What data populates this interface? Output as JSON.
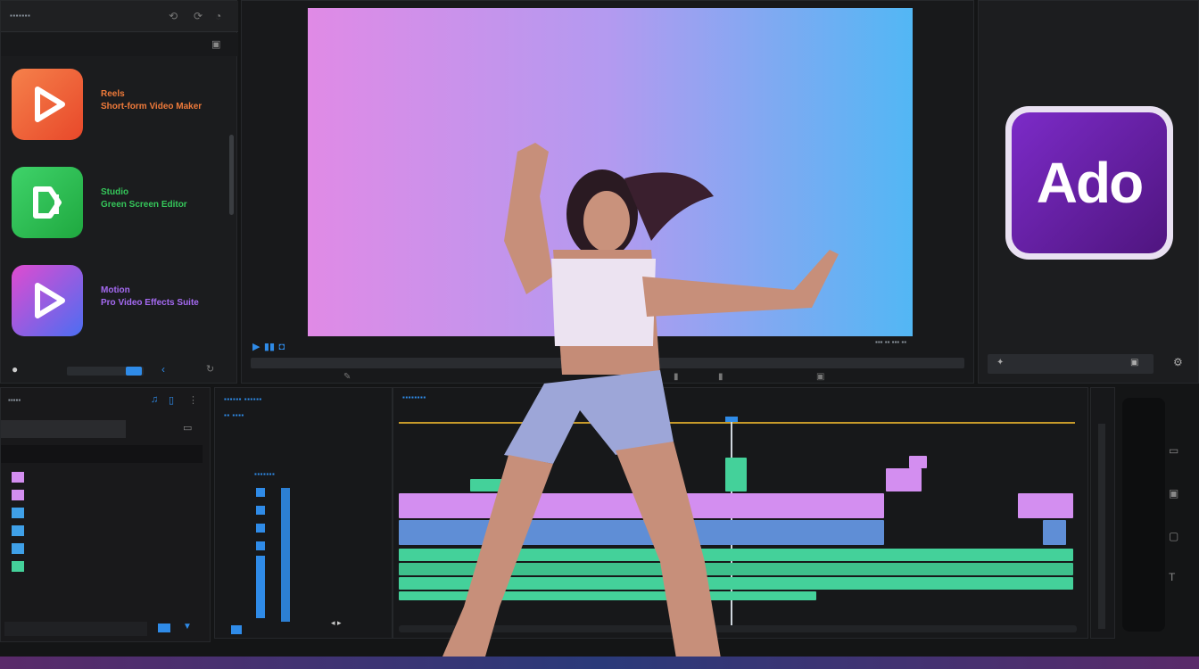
{
  "window": {
    "title": "Ado"
  },
  "left_panel": {
    "header_label": "",
    "apps": [
      {
        "name": "Reels",
        "subtitle": "Short-form Video Maker",
        "color": "#ef6a2c"
      },
      {
        "name": "Studio",
        "subtitle": "Green Screen Editor",
        "color": "#28b84b"
      },
      {
        "name": "Motion",
        "subtitle": "Pro Video Effects Suite",
        "color": "#7a4cf0"
      }
    ]
  },
  "brand": {
    "logo_text": "Ado",
    "accent": "#6a1fb8"
  },
  "preview": {
    "gradient_start": "#e58ae8",
    "gradient_end": "#4fb6f4"
  },
  "colors": {
    "clip_purple": "#d38ef0",
    "clip_blue": "#5f8ed6",
    "clip_green": "#44d19a",
    "playhead": "#cfd6dd",
    "ruler": "#c79a2a",
    "accent_blue": "#2f8be8"
  },
  "icons": {
    "play": "play-icon",
    "scissors": "scissors-icon",
    "settings": "gear-icon",
    "marker": "marker-icon"
  }
}
